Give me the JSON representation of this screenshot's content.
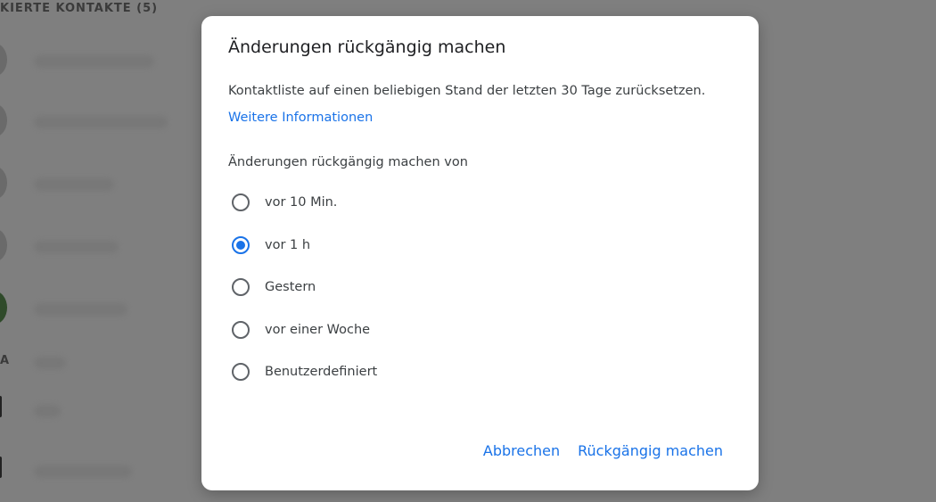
{
  "background": {
    "section_heading": "KIERTE KONTAKTE (5)",
    "section_heading_2": "A"
  },
  "dialog": {
    "title": "Änderungen rückgängig machen",
    "description": "Kontaktliste auf einen beliebigen Stand der letzten 30 Tage zurücksetzen.",
    "more_info_link": "Weitere Informationen",
    "options_label": "Änderungen rückgängig machen von",
    "options": [
      {
        "label": "vor 10 Min.",
        "selected": false
      },
      {
        "label": "vor 1 h",
        "selected": true
      },
      {
        "label": "Gestern",
        "selected": false
      },
      {
        "label": "vor einer Woche",
        "selected": false
      },
      {
        "label": "Benutzerdefiniert",
        "selected": false
      }
    ],
    "cancel_label": "Abbrechen",
    "confirm_label": "Rückgängig machen"
  },
  "colors": {
    "accent": "#1a73e8",
    "overlay": "#7f7f7f"
  }
}
